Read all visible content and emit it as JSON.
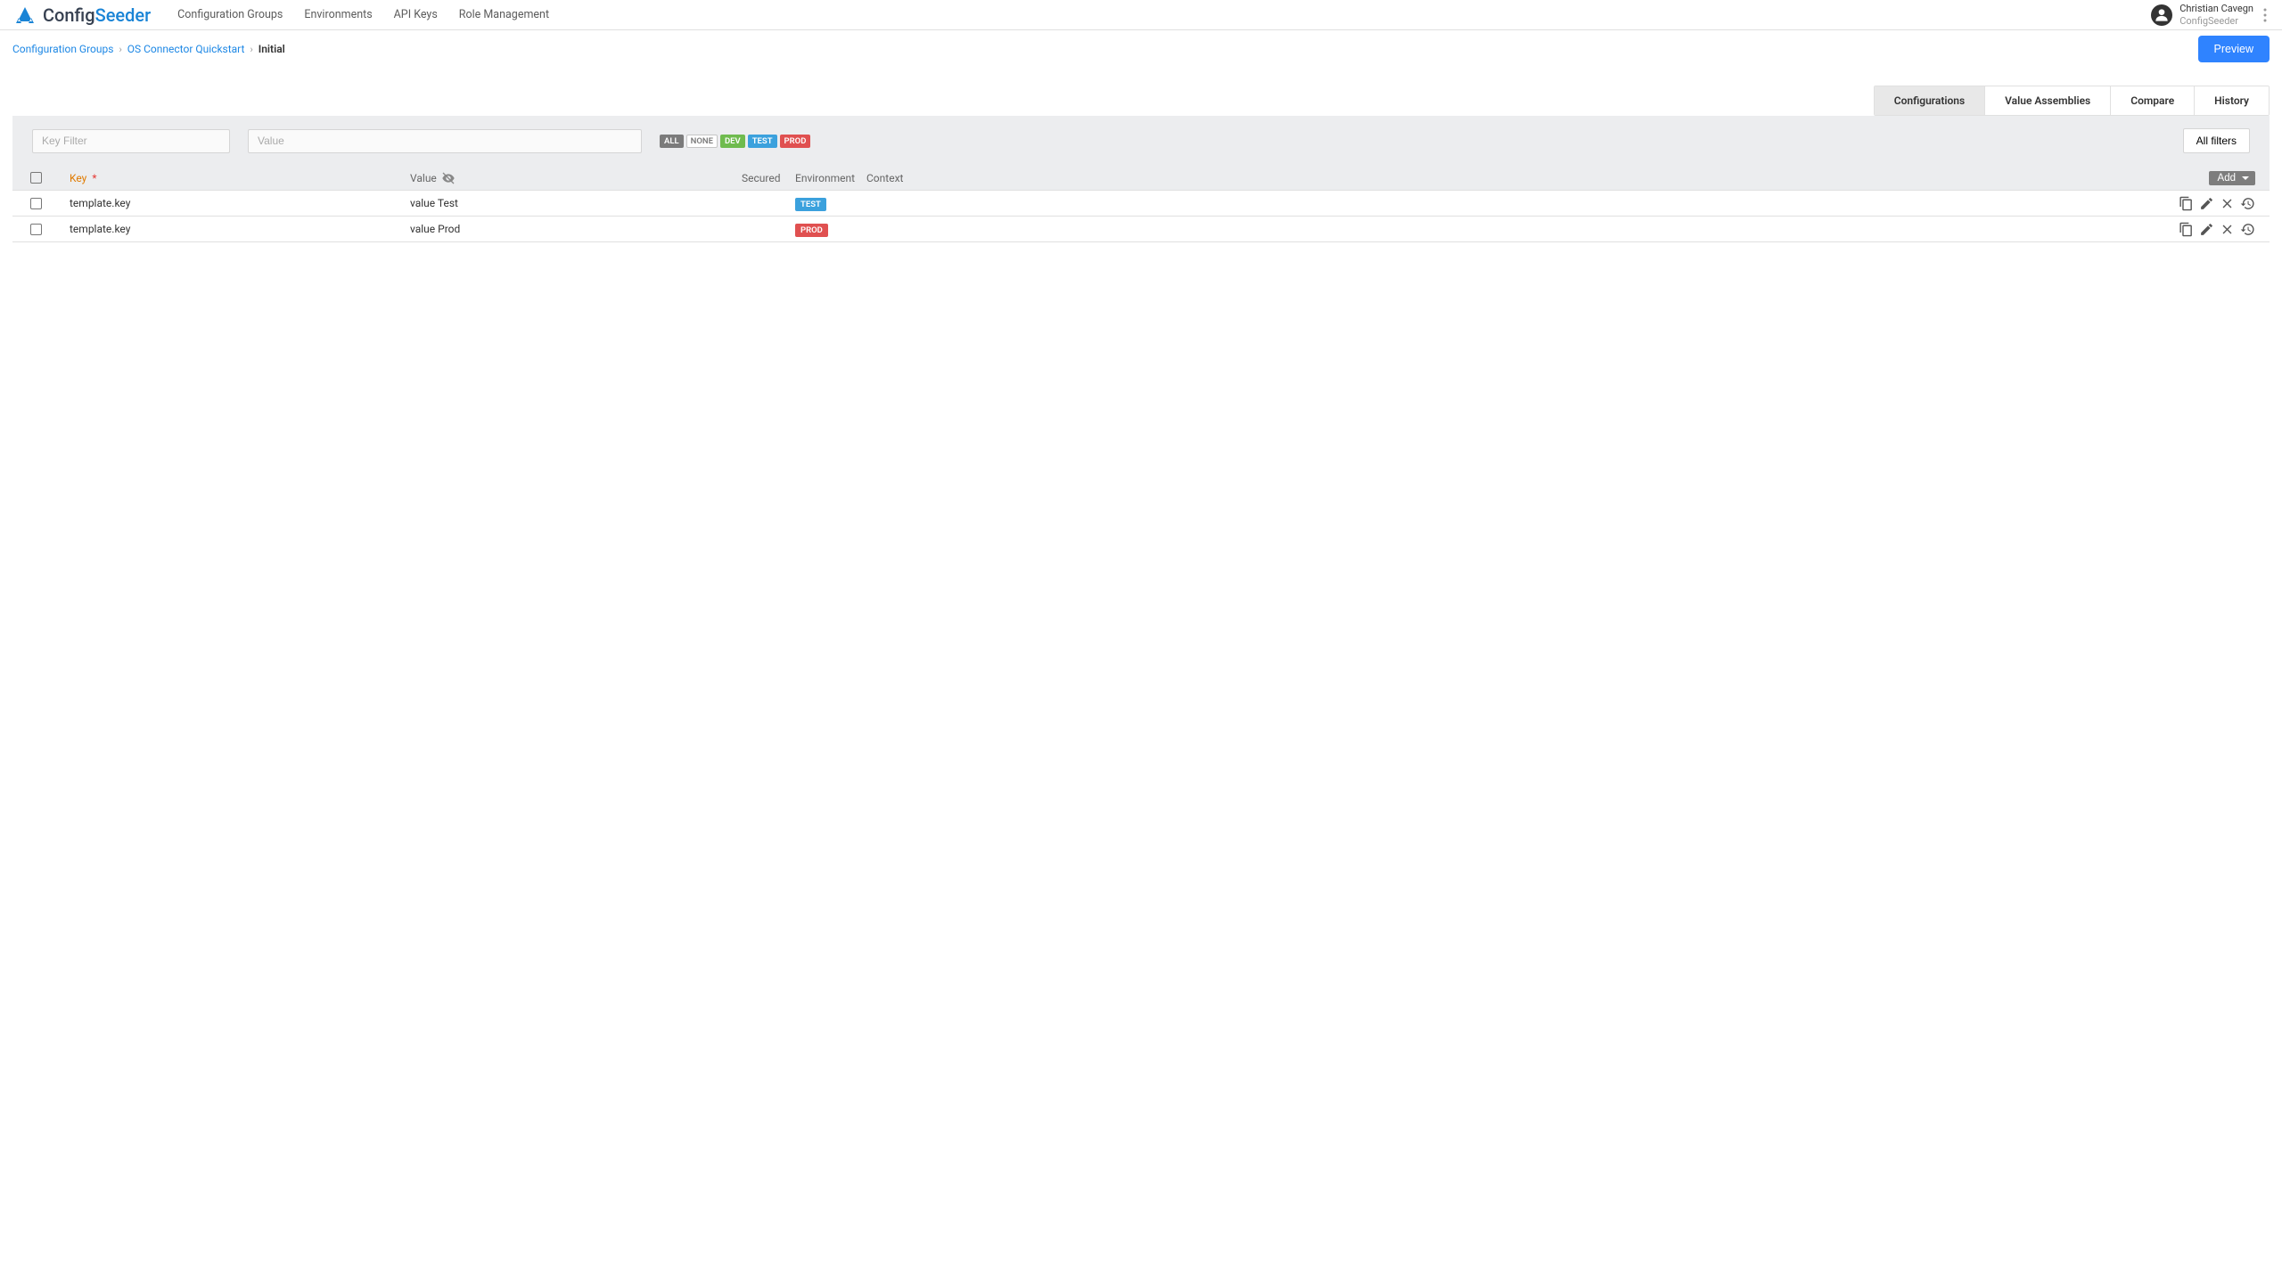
{
  "app": {
    "name1": "Config",
    "name2": "Seeder"
  },
  "nav": {
    "config_groups": "Configuration Groups",
    "environments": "Environments",
    "api_keys": "API Keys",
    "role_management": "Role Management"
  },
  "user": {
    "name": "Christian Cavegn",
    "org": "ConfigSeeder"
  },
  "breadcrumb": {
    "l1": "Configuration Groups",
    "l2": "OS Connector Quickstart",
    "l3": "Initial"
  },
  "buttons": {
    "preview": "Preview",
    "all_filters": "All filters",
    "add": "Add"
  },
  "tabs": {
    "configurations": "Configurations",
    "value_assemblies": "Value Assemblies",
    "compare": "Compare",
    "history": "History"
  },
  "filters": {
    "key_placeholder": "Key Filter",
    "value_placeholder": "Value"
  },
  "chips": {
    "all": "ALL",
    "none": "NONE",
    "dev": "DEV",
    "test": "TEST",
    "prod": "PROD"
  },
  "columns": {
    "key": "Key",
    "value": "Value",
    "secured": "Secured",
    "environment": "Environment",
    "context": "Context"
  },
  "rows": [
    {
      "key": "template.key",
      "value": "value Test",
      "env_label": "TEST",
      "env_class": "test"
    },
    {
      "key": "template.key",
      "value": "value Prod",
      "env_label": "PROD",
      "env_class": "prod"
    }
  ]
}
